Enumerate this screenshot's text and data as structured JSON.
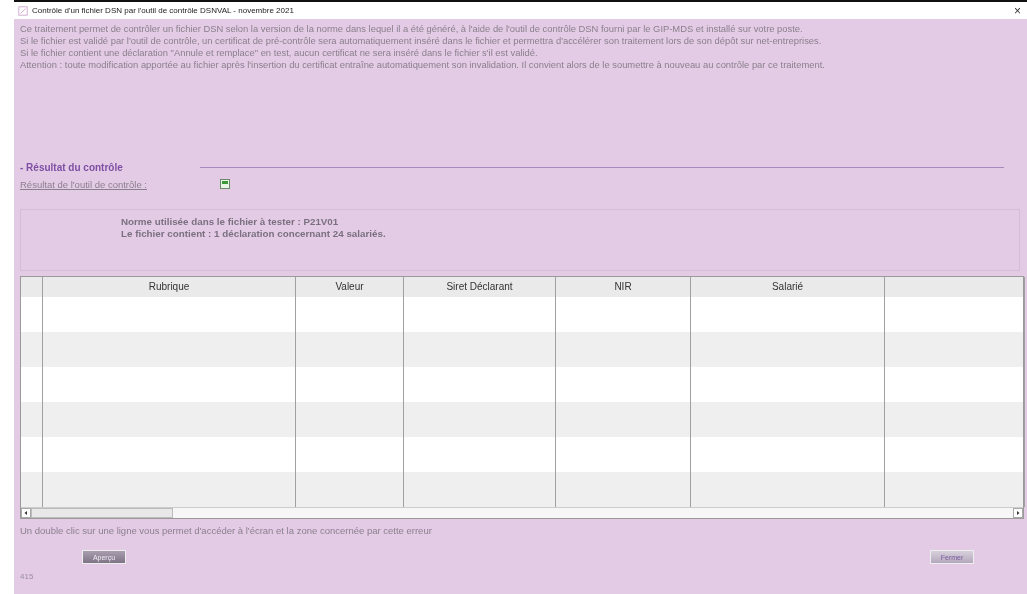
{
  "window": {
    "title": "Contrôle d'un fichier DSN par l'outil de contrôle DSNVAL - novembre 2021",
    "close": "×"
  },
  "intro": [
    "Ce traitement permet de contrôler un fichier DSN selon la version de la norme dans lequel il a été généré, à l'aide de l'outil de contrôle DSN fourni par le GIP-MDS et installé sur votre poste.",
    "Si le fichier est validé par l'outil de contrôle, un certificat de pré-contrôle sera automatiquement inséré dans le fichier et permettra d'accélérer son traitement lors de son dépôt sur net-entreprises.",
    "Si le fichier contient une déclaration \"Annule et remplace\" en test, aucun certificat ne sera inséré dans le fichier s'il est validé.",
    "Attention : toute modification apportée au fichier après l'insertion du certificat entraîne automatiquement son invalidation. Il convient alors de le soumettre à nouveau au contrôle par ce traitement."
  ],
  "section": {
    "title": "- Résultat du contrôle",
    "result_label": "Résultat de l'outil de contrôle :"
  },
  "summary": [
    "Norme utilisée dans le fichier à tester : P21V01",
    "Le fichier contient : 1 déclaration concernant 24 salariés."
  ],
  "table": {
    "columns": [
      "",
      "Rubrique",
      "Valeur",
      "Siret Déclarant",
      "NIR",
      "Salarié",
      ""
    ]
  },
  "hint": "Un double clic sur une ligne vous permet d'accéder à l'écran et la zone concernée par cette erreur",
  "buttons": [
    {
      "label": "Aperçu",
      "disabled": true
    },
    {
      "label": "Fermer",
      "disabled": false
    }
  ],
  "status": "415"
}
